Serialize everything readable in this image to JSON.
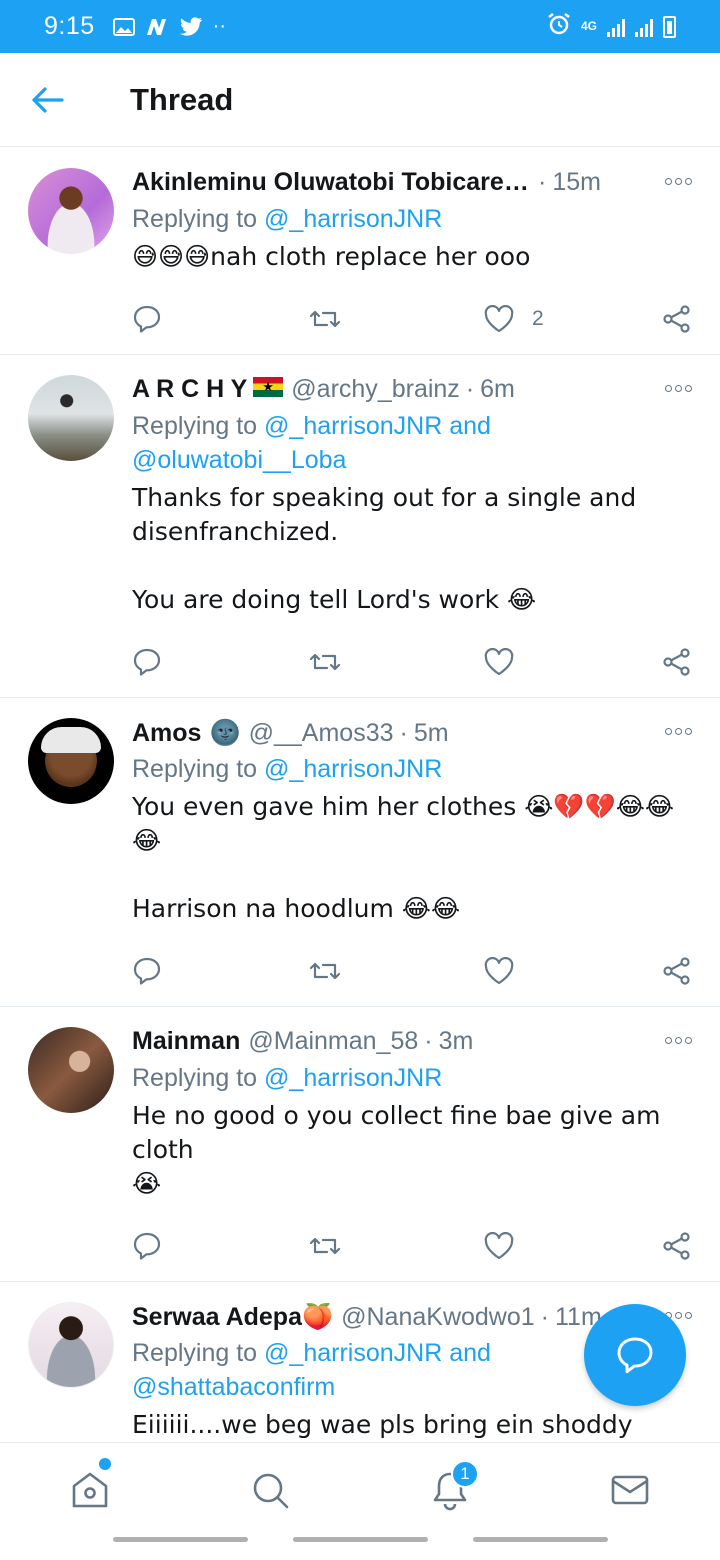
{
  "status_bar": {
    "time": "9:15",
    "network": "4G",
    "icons": [
      "gallery-icon",
      "n-app-icon",
      "twitter-icon",
      "more-dots-icon",
      "alarm-icon",
      "signal-icon",
      "battery-icon"
    ]
  },
  "header": {
    "title": "Thread"
  },
  "tweets": [
    {
      "name": "Akinleminu Oluwatobi Tobicares …",
      "handle": "",
      "time": "15m",
      "reply_prefix": "Replying to",
      "reply_to": "@_harrisonJNR",
      "reply_to_2": "",
      "text": "😅😅😅nah cloth replace her ooo",
      "likes": "2"
    },
    {
      "name": "A R C H Y",
      "handle": "@archy_brainz",
      "time": "6m",
      "reply_prefix": "Replying to",
      "reply_to": "@_harrisonJNR and",
      "reply_to_2": "@oluwatobi__Loba",
      "text": "Thanks for speaking out for a single and disenfranchized.\n\nYou are doing tell Lord's work 😂",
      "likes": ""
    },
    {
      "name": "Amos",
      "name_emoji": "🌚",
      "handle": "@__Amos33",
      "time": "5m",
      "reply_prefix": "Replying to",
      "reply_to": "@_harrisonJNR",
      "reply_to_2": "",
      "text": "You even gave him her clothes 😭💔💔😂😂\n😂\n\nHarrison na hoodlum 😂😂",
      "likes": ""
    },
    {
      "name": "Mainman",
      "handle": "@Mainman_58",
      "time": "3m",
      "reply_prefix": "Replying to",
      "reply_to": "@_harrisonJNR",
      "reply_to_2": "",
      "text": "He no good o you collect fine bae give am cloth\n😭",
      "likes": ""
    },
    {
      "name": "Serwaa Adepa",
      "name_emoji": "🍑",
      "handle": "@NanaKwodwo1",
      "time": "11m",
      "reply_prefix": "Replying to",
      "reply_to": "@_harrisonJNR and",
      "reply_to_2": "@shattabaconfirm",
      "text": "Eiiiiii....we beg wae pls bring ein shoddy\n🤭🤭",
      "likes": ""
    }
  ],
  "bottom_nav": {
    "items": [
      "home-icon",
      "search-icon",
      "notifications-icon",
      "messages-icon"
    ],
    "notification_count": "1"
  },
  "colors": {
    "accent": "#1da1f2",
    "muted": "#657786",
    "text": "#14171a"
  }
}
